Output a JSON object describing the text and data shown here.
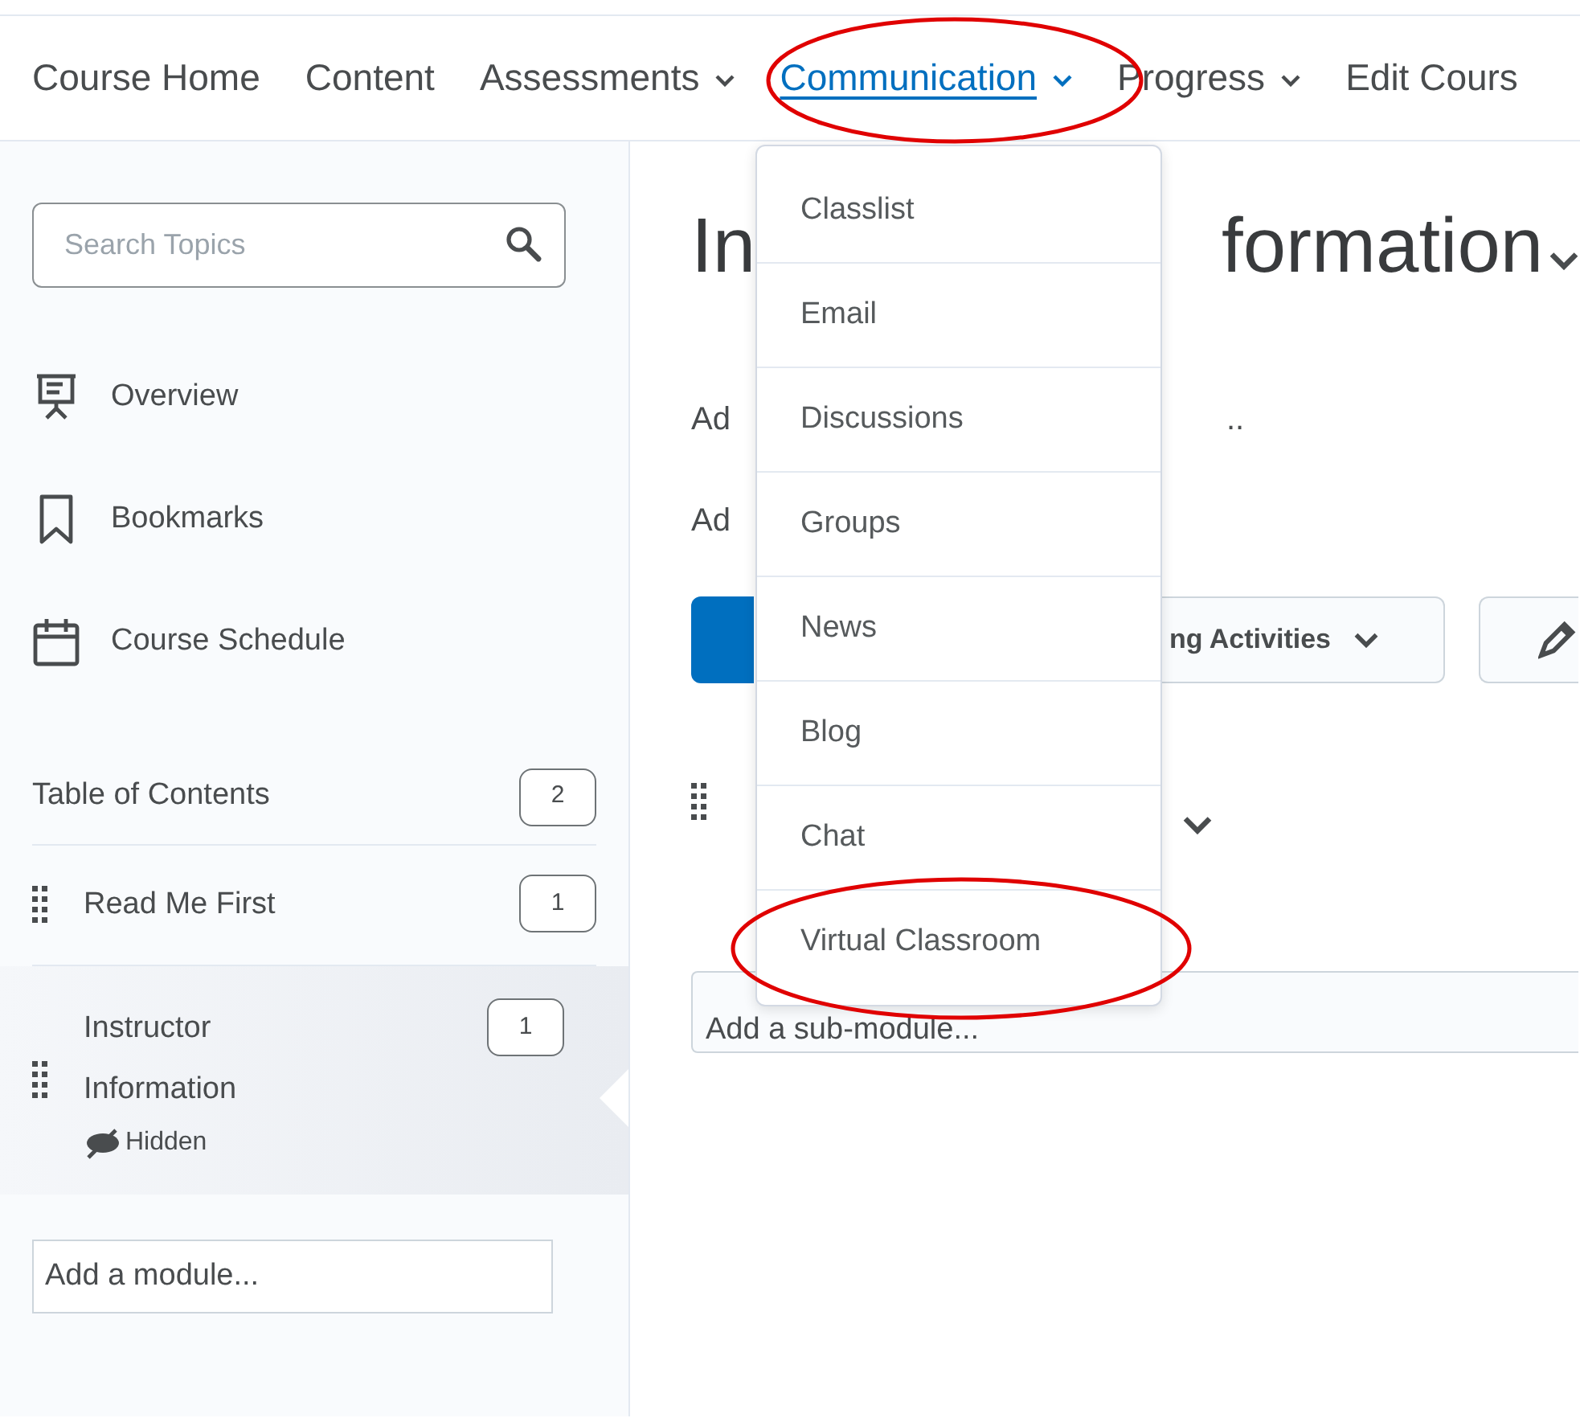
{
  "nav": {
    "items": [
      {
        "label": "Course Home",
        "has_menu": false,
        "selected": false
      },
      {
        "label": "Content",
        "has_menu": false,
        "selected": false
      },
      {
        "label": "Assessments",
        "has_menu": true,
        "selected": false
      },
      {
        "label": "Communication",
        "has_menu": true,
        "selected": true
      },
      {
        "label": "Progress",
        "has_menu": true,
        "selected": false
      },
      {
        "label": "Edit Cours",
        "has_menu": false,
        "selected": false
      }
    ]
  },
  "sidebar": {
    "search": {
      "placeholder": "Search Topics"
    },
    "links": [
      {
        "label": "Overview",
        "kind": "presentation"
      },
      {
        "label": "Bookmarks",
        "kind": "bookmark"
      },
      {
        "label": "Course Schedule",
        "kind": "calendar"
      }
    ],
    "table_of_contents": {
      "label": "Table of Contents",
      "count": "2"
    },
    "modules": [
      {
        "label": "Read Me First",
        "count": "1",
        "selected": false,
        "hidden": false
      },
      {
        "label": "Instructor Information",
        "count": "1",
        "selected": true,
        "hidden": true,
        "status": "Hidden"
      }
    ],
    "add_module": {
      "placeholder": "Add a module..."
    }
  },
  "main": {
    "title_start": "In",
    "title_end": "formation",
    "line_1_start": "Ad",
    "line_1_end": "..",
    "line_2_start": "Ad",
    "activities_button": "ng Activities",
    "add_submodule": {
      "placeholder": "Add a sub-module..."
    }
  },
  "dropdown": {
    "items": [
      "Classlist",
      "Email",
      "Discussions",
      "Groups",
      "News",
      "Blog",
      "Chat",
      "Virtual Classroom"
    ]
  }
}
